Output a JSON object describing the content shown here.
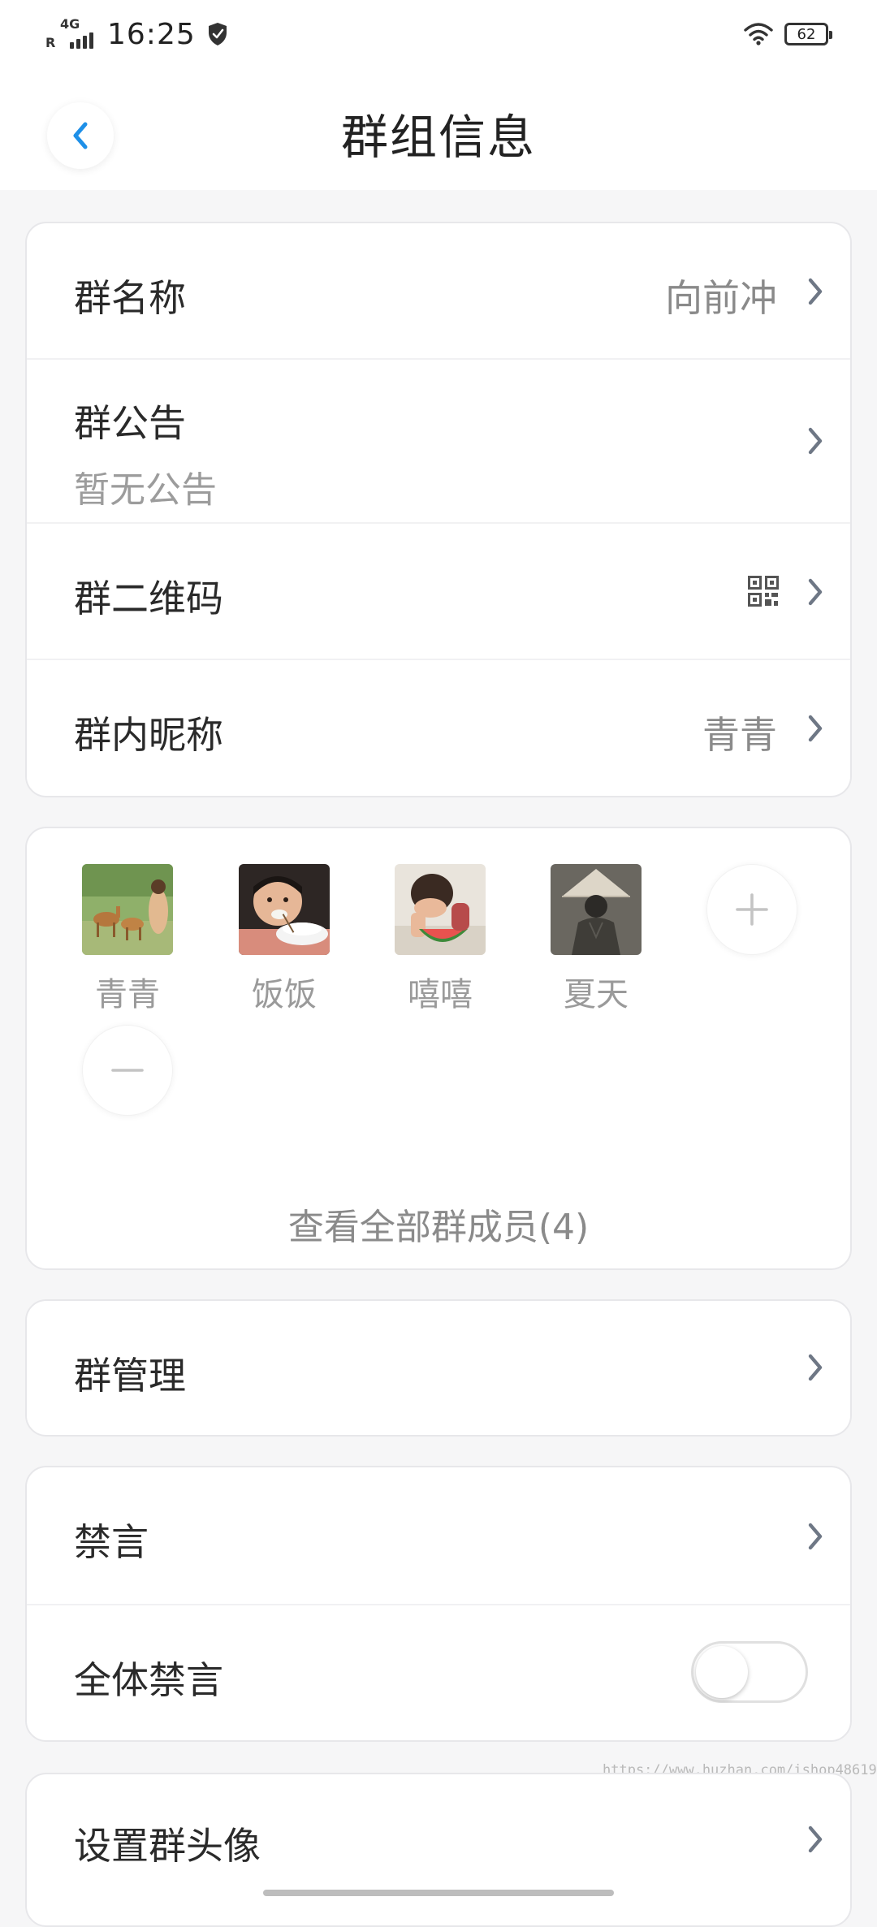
{
  "status_bar": {
    "network_sub": "R",
    "network_type": "4G",
    "time": "16:25",
    "battery": "62"
  },
  "header": {
    "title": "群组信息"
  },
  "info_card": {
    "group_name_label": "群名称",
    "group_name_value": "向前冲",
    "announcement_label": "群公告",
    "announcement_value": "暂无公告",
    "qrcode_label": "群二维码",
    "nickname_label": "群内昵称",
    "nickname_value": "青青"
  },
  "members_card": {
    "members": [
      {
        "name": "青青",
        "avatar": "deer-photo"
      },
      {
        "name": "饭饭",
        "avatar": "child-eating-rice-photo"
      },
      {
        "name": "嘻嘻",
        "avatar": "child-eating-watermelon-photo"
      },
      {
        "name": "夏天",
        "avatar": "person-in-straw-hat-photo"
      }
    ],
    "view_all": "查看全部群成员(4)"
  },
  "manage_card": {
    "label": "群管理"
  },
  "mute_card": {
    "mute_label": "禁言",
    "mute_all_label": "全体禁言",
    "mute_all_on": false
  },
  "avatar_card": {
    "label": "设置群头像"
  },
  "watermark": "https://www.huzhan.com/ishop48619",
  "colors": {
    "accent": "#1e90e8",
    "background": "#f6f6f7",
    "card": "#ffffff",
    "secondary_text": "#8a8a8a"
  }
}
